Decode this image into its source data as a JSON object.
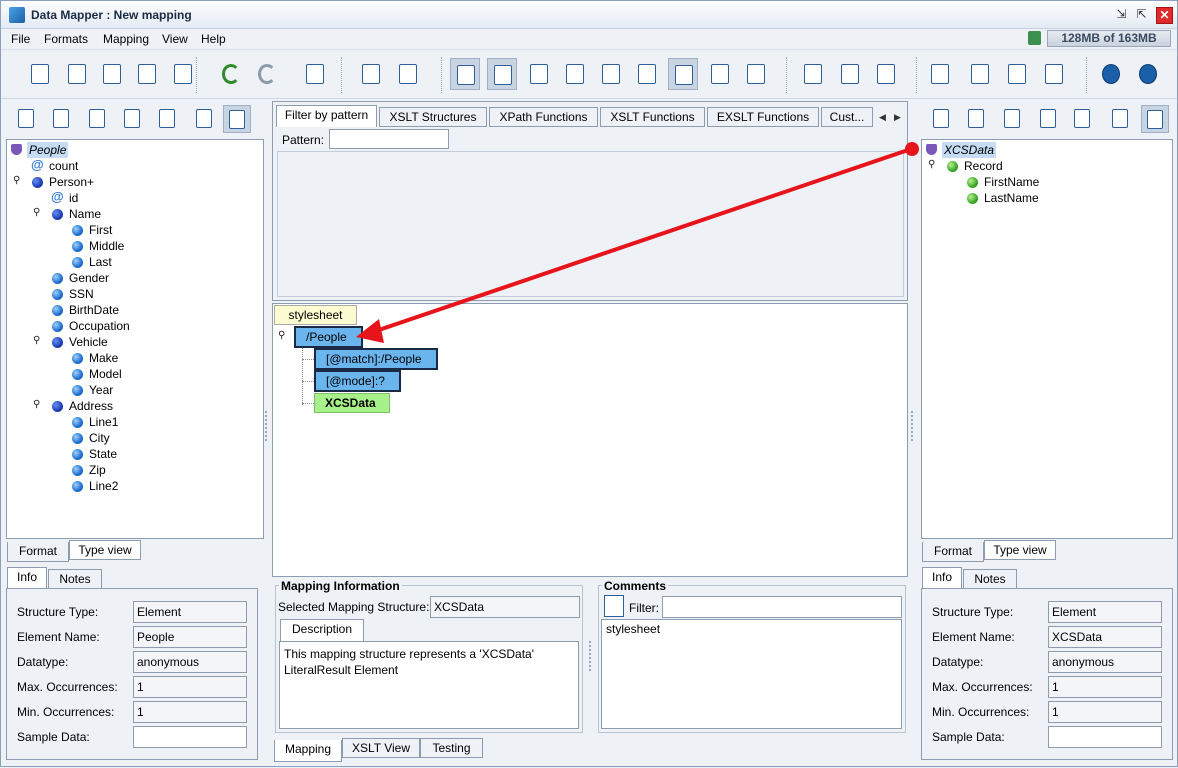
{
  "window": {
    "title": "Data Mapper : New mapping",
    "memory": "128MB of 163MB"
  },
  "menu": [
    "File",
    "Formats",
    "Mapping",
    "View",
    "Help"
  ],
  "toolbar_icons": [
    "new-mapping-icon",
    "open-icon",
    "save-icon",
    "save-as-icon",
    "export-xls-icon",
    "undo-icon",
    "redo-icon",
    "exit-icon",
    "add-structure-icon",
    "structure-settings-icon",
    "info-view-icon",
    "color-view-icon",
    "list-view-icon",
    "xslt-code-icon",
    "save-disk-icon",
    "transform-icon",
    "xpath-icon",
    "table-icon",
    "database-icon",
    "cut-icon",
    "copy-icon",
    "paste-icon",
    "align-icon",
    "import-icon",
    "merge-icon",
    "layers-icon",
    "help-icon",
    "about-icon"
  ],
  "left": {
    "tree": [
      {
        "label": "People",
        "type": "root",
        "depth": 0
      },
      {
        "label": "count",
        "type": "attr",
        "depth": 1
      },
      {
        "label": "Person+",
        "type": "elem-dark",
        "depth": 1,
        "expanded": true
      },
      {
        "label": "id",
        "type": "attr",
        "depth": 2
      },
      {
        "label": "Name",
        "type": "elem-dark",
        "depth": 2,
        "expanded": true
      },
      {
        "label": "First",
        "type": "leaf",
        "depth": 3
      },
      {
        "label": "Middle",
        "type": "leaf",
        "depth": 3
      },
      {
        "label": "Last",
        "type": "leaf",
        "depth": 3
      },
      {
        "label": "Gender",
        "type": "leaf",
        "depth": 2
      },
      {
        "label": "SSN",
        "type": "leaf",
        "depth": 2
      },
      {
        "label": "BirthDate",
        "type": "leaf",
        "depth": 2
      },
      {
        "label": "Occupation",
        "type": "leaf",
        "depth": 2
      },
      {
        "label": "Vehicle",
        "type": "elem-dark",
        "depth": 2,
        "expanded": true
      },
      {
        "label": "Make",
        "type": "leaf",
        "depth": 3
      },
      {
        "label": "Model",
        "type": "leaf",
        "depth": 3
      },
      {
        "label": "Year",
        "type": "leaf",
        "depth": 3
      },
      {
        "label": "Address",
        "type": "elem-dark",
        "depth": 2,
        "expanded": true
      },
      {
        "label": "Line1",
        "type": "leaf",
        "depth": 3
      },
      {
        "label": "City",
        "type": "leaf",
        "depth": 3
      },
      {
        "label": "State",
        "type": "leaf",
        "depth": 3
      },
      {
        "label": "Zip",
        "type": "leaf",
        "depth": 3
      },
      {
        "label": "Line2",
        "type": "leaf",
        "depth": 3
      }
    ],
    "view_tabs": [
      "Format",
      "Type view"
    ],
    "info_tabs": [
      "Info",
      "Notes"
    ],
    "info": {
      "structure_type_label": "Structure Type:",
      "structure_type": "Element",
      "element_name_label": "Element Name:",
      "element_name": "People",
      "datatype_label": "Datatype:",
      "datatype": "anonymous",
      "max_occ_label": "Max. Occurrences:",
      "max_occ": "1",
      "min_occ_label": "Min. Occurrences:",
      "min_occ": "1",
      "sample_label": "Sample Data:",
      "sample": ""
    }
  },
  "center": {
    "tabs": [
      "Filter by pattern",
      "XSLT Structures",
      "XPath Functions",
      "XSLT Functions",
      "EXSLT Functions",
      "Cust..."
    ],
    "pattern_label": "Pattern:",
    "pattern_value": "",
    "map": {
      "stylesheet": "stylesheet",
      "people": "/People",
      "match": "[@match]:/People",
      "mode": "[@mode]:?",
      "xcsdata": "XCSData"
    },
    "mapping_info": {
      "title": "Mapping Information",
      "selected_label": "Selected Mapping Structure:",
      "selected_value": "XCSData",
      "desc_tab": "Description",
      "description": "This mapping structure represents a 'XCSData' LiteralResult Element"
    },
    "comments": {
      "title": "Comments",
      "filter_label": "Filter:",
      "filter_value": "",
      "items": [
        "stylesheet"
      ]
    },
    "bottom_tabs": [
      "Mapping",
      "XSLT View",
      "Testing"
    ]
  },
  "right": {
    "tree": [
      {
        "label": "XCSData",
        "type": "root",
        "depth": 0
      },
      {
        "label": "Record",
        "type": "elem-green",
        "depth": 1,
        "expanded": true
      },
      {
        "label": "FirstName",
        "type": "leaf-green",
        "depth": 2
      },
      {
        "label": "LastName",
        "type": "leaf-green",
        "depth": 2
      }
    ],
    "view_tabs": [
      "Format",
      "Type view"
    ],
    "info_tabs": [
      "Info",
      "Notes"
    ],
    "info": {
      "structure_type_label": "Structure Type:",
      "structure_type": "Element",
      "element_name_label": "Element Name:",
      "element_name": "XCSData",
      "datatype_label": "Datatype:",
      "datatype": "anonymous",
      "max_occ_label": "Max. Occurrences:",
      "max_occ": "1",
      "min_occ_label": "Min. Occurrences:",
      "min_occ": "1",
      "sample_label": "Sample Data:",
      "sample": ""
    }
  },
  "colors": {
    "arrow": "#e8141b",
    "selected_bg": "#c6dcf5",
    "box_blue": "#6bb5ee",
    "box_green": "#a8f08a",
    "box_yellow": "#fdfbd2"
  }
}
